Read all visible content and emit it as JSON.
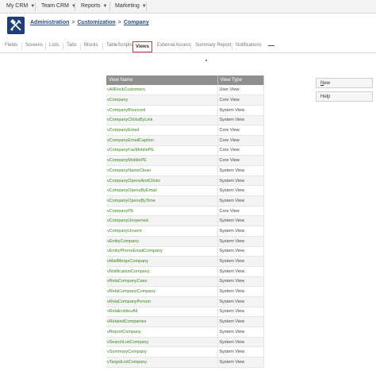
{
  "topnav": [
    {
      "label": "My CRM"
    },
    {
      "label": "Team CRM"
    },
    {
      "label": "Reports"
    },
    {
      "label": "Marketing"
    }
  ],
  "breadcrumb": {
    "item1": "Administration",
    "sep1": ">",
    "item2": "Customization",
    "sep2": ">",
    "item3": "Company"
  },
  "tabs": [
    "Fields",
    "Screens",
    "Lists",
    "Tabs",
    "Blocks",
    "TableScripts",
    "Views",
    "External Access",
    "Summary Report",
    "Notifications"
  ],
  "active_tab": "Views",
  "tab_more": "—",
  "grid": {
    "headers": {
      "name": "View Name",
      "type": "View Type"
    },
    "rows": [
      {
        "name": "vAllRockCustomers",
        "type": "User View"
      },
      {
        "name": "vCompany",
        "type": "Core View"
      },
      {
        "name": "vCompanyBounced",
        "type": "System View"
      },
      {
        "name": "vCompanyClicksByLink",
        "type": "System View"
      },
      {
        "name": "vCompanyEmail",
        "type": "Core View"
      },
      {
        "name": "vCompanyEmailCaption",
        "type": "Core View"
      },
      {
        "name": "vCompanyFaxMobilePE",
        "type": "Core View"
      },
      {
        "name": "vCompanyMobilePE",
        "type": "Core View"
      },
      {
        "name": "vCompanyNameClean",
        "type": "System View"
      },
      {
        "name": "vCompanyOpensAndClicks",
        "type": "System View"
      },
      {
        "name": "vCompanyOpensByEmail",
        "type": "System View"
      },
      {
        "name": "vCompanyOpensByTime",
        "type": "System View"
      },
      {
        "name": "vCompanyPE",
        "type": "Core View"
      },
      {
        "name": "vCompanyUnopened",
        "type": "System View"
      },
      {
        "name": "vCompanyUnsent",
        "type": "System View"
      },
      {
        "name": "vEntityCompany",
        "type": "System View"
      },
      {
        "name": "vEntityPhoneEmailCompany",
        "type": "System View"
      },
      {
        "name": "vMailMergeCompany",
        "type": "System View"
      },
      {
        "name": "vNotificationCompany",
        "type": "System View"
      },
      {
        "name": "vRelaCompanyCase",
        "type": "System View"
      },
      {
        "name": "vRelaCompanyCompany",
        "type": "System View"
      },
      {
        "name": "vRelaCompanyPerson",
        "type": "System View"
      },
      {
        "name": "vRelaEntitiesAll",
        "type": "System View"
      },
      {
        "name": "vRelatedCompanies",
        "type": "System View"
      },
      {
        "name": "vReportCompany",
        "type": "System View"
      },
      {
        "name": "vSearchListCompany",
        "type": "System View"
      },
      {
        "name": "vSummaryCompany",
        "type": "System View"
      },
      {
        "name": "vTargetListCompany",
        "type": "System View"
      }
    ]
  },
  "side_buttons": {
    "new": {
      "label": "New",
      "underline": "N",
      "rest": "ew"
    },
    "help": {
      "label": "Help"
    }
  },
  "icons": {
    "logo": "tools-icon",
    "chevron": "chevron-down-icon"
  },
  "colors": {
    "logo_bg": "#1f3f7a",
    "link_green": "#3a8a1e",
    "active_tab_border": "#cc3b3b",
    "header_gray": "#8f8f8f"
  }
}
